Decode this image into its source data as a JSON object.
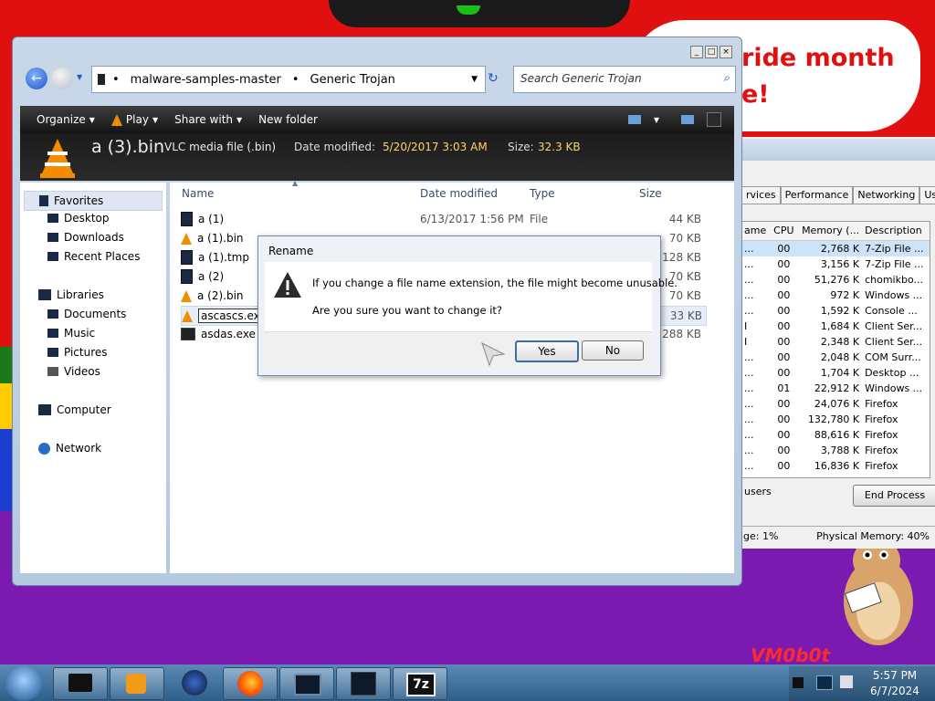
{
  "desktop": {
    "banner_line1": "ride month",
    "banner_line2": "e!",
    "watermark": "VM0b0t"
  },
  "task_manager": {
    "tabs": [
      "rvices",
      "Performance",
      "Networking",
      "Users"
    ],
    "columns": [
      "ame",
      "CPU",
      "Memory (...",
      "Description"
    ],
    "rows": [
      {
        "name": "...",
        "cpu": "00",
        "mem": "2,768 K",
        "desc": "7-Zip File ..."
      },
      {
        "name": "...",
        "cpu": "00",
        "mem": "3,156 K",
        "desc": "7-Zip File ..."
      },
      {
        "name": "...",
        "cpu": "00",
        "mem": "51,276 K",
        "desc": "chomikbo..."
      },
      {
        "name": "...",
        "cpu": "00",
        "mem": "972 K",
        "desc": "Windows ..."
      },
      {
        "name": "...",
        "cpu": "00",
        "mem": "1,592 K",
        "desc": "Console ..."
      },
      {
        "name": "I",
        "cpu": "00",
        "mem": "1,684 K",
        "desc": "Client Ser..."
      },
      {
        "name": "I",
        "cpu": "00",
        "mem": "2,348 K",
        "desc": "Client Ser..."
      },
      {
        "name": "...",
        "cpu": "00",
        "mem": "2,048 K",
        "desc": "COM Surr..."
      },
      {
        "name": "...",
        "cpu": "00",
        "mem": "1,704 K",
        "desc": "Desktop ..."
      },
      {
        "name": "...",
        "cpu": "01",
        "mem": "22,912 K",
        "desc": "Windows ..."
      },
      {
        "name": "...",
        "cpu": "00",
        "mem": "24,076 K",
        "desc": "Firefox"
      },
      {
        "name": "...",
        "cpu": "00",
        "mem": "132,780 K",
        "desc": "Firefox"
      },
      {
        "name": "...",
        "cpu": "00",
        "mem": "88,616 K",
        "desc": "Firefox"
      },
      {
        "name": "...",
        "cpu": "00",
        "mem": "3,788 K",
        "desc": "Firefox"
      },
      {
        "name": "...",
        "cpu": "00",
        "mem": "16,836 K",
        "desc": "Firefox"
      }
    ],
    "users_label": "users",
    "end_process": "End Process",
    "status_cpu": "ge: 1%",
    "status_memory": "Physical Memory: 40%"
  },
  "explorer": {
    "breadcrumb": [
      "malware-samples-master",
      "Generic Trojan"
    ],
    "search_placeholder": "Search Generic Trojan",
    "toolbar": {
      "organize": "Organize",
      "play": "Play",
      "share_with": "Share with",
      "new_folder": "New folder"
    },
    "details": {
      "filename": "a (3).bin",
      "type": "VLC media file (.bin)",
      "date_label": "Date modified:",
      "date_value": "5/20/2017 3:03 AM",
      "size_label": "Size:",
      "size_value": "32.3 KB"
    },
    "nav": {
      "favorites": "Favorites",
      "desktop": "Desktop",
      "downloads": "Downloads",
      "recent_places": "Recent Places",
      "libraries": "Libraries",
      "documents": "Documents",
      "music": "Music",
      "pictures": "Pictures",
      "videos": "Videos",
      "computer": "Computer",
      "network": "Network"
    },
    "columns": {
      "name": "Name",
      "date": "Date modified",
      "type": "Type",
      "size": "Size"
    },
    "files": [
      {
        "name": "a (1)",
        "date": "6/13/2017 1:56 PM",
        "type": "File",
        "size": "44 KB",
        "icon": "file"
      },
      {
        "name": "a (1).bin",
        "date": "",
        "type": "",
        "size": "70 KB",
        "icon": "vlc"
      },
      {
        "name": "a (1).tmp",
        "date": "",
        "type": "",
        "size": "128 KB",
        "icon": "file"
      },
      {
        "name": "a (2)",
        "date": "",
        "type": "",
        "size": "70 KB",
        "icon": "file"
      },
      {
        "name": "a (2).bin",
        "date": "",
        "type": "",
        "size": "70 KB",
        "icon": "vlc"
      },
      {
        "name": "ascascs.exe",
        "date": "",
        "type": "",
        "size": "33 KB",
        "icon": "vlc"
      },
      {
        "name": "asdas.exe",
        "date": "",
        "type": "",
        "size": "288 KB",
        "icon": "exe"
      }
    ]
  },
  "dialog": {
    "title": "Rename",
    "message": "If you change a file name extension, the file might become unusable.",
    "question": "Are you sure you want to change it?",
    "yes": "Yes",
    "no": "No"
  },
  "taskbar": {
    "time": "5:57 PM",
    "date": "6/7/2024",
    "zip_label": "7z"
  }
}
